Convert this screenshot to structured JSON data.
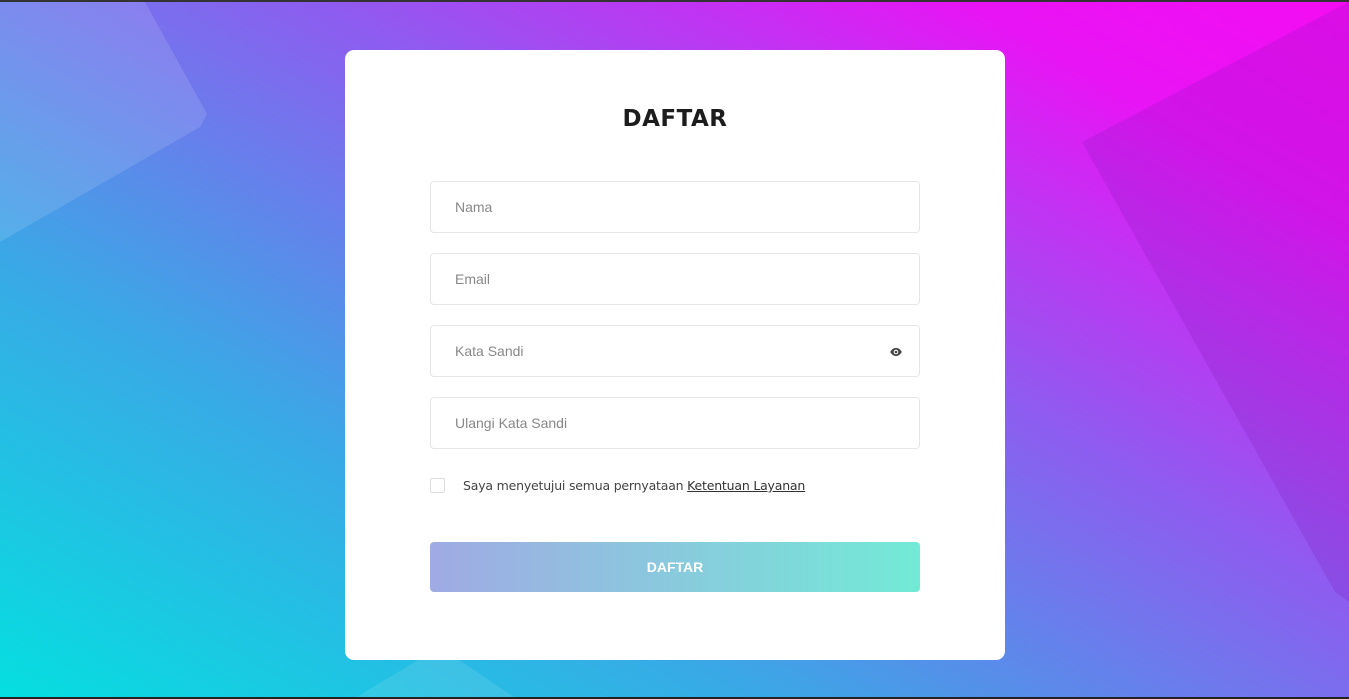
{
  "title": "DAFTAR",
  "fields": {
    "name": {
      "placeholder": "Nama",
      "value": ""
    },
    "email": {
      "placeholder": "Email",
      "value": ""
    },
    "password": {
      "placeholder": "Kata Sandi",
      "value": ""
    },
    "confirm": {
      "placeholder": "Ulangi Kata Sandi",
      "value": ""
    }
  },
  "terms": {
    "text": "Saya menyetujui semua pernyataan ",
    "link": "Ketentuan Layanan",
    "checked": false
  },
  "submit_label": "DAFTAR",
  "colors": {
    "button_start": "#a0aae4",
    "button_end": "#72ead6",
    "bg_start": "#05dfe0",
    "bg_end": "#f40cf2"
  }
}
